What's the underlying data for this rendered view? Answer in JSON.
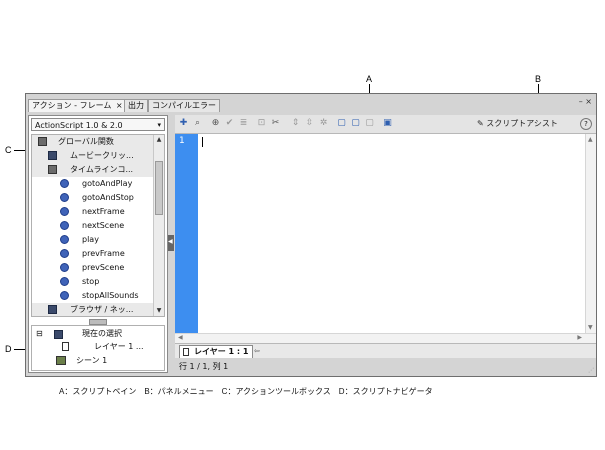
{
  "callouts": {
    "a": "A",
    "b": "B",
    "c": "C",
    "d": "D"
  },
  "tabs": [
    {
      "label": "アクション - フレーム",
      "close": "×"
    },
    {
      "label": "出力"
    },
    {
      "label": "コンパイルエラー"
    }
  ],
  "window_controls": {
    "min": "–",
    "close": "×"
  },
  "language_select": {
    "value": "ActionScript 1.0 & 2.0",
    "arrow": "▾"
  },
  "toolbox": {
    "items": [
      {
        "label": "グローバル関数",
        "kind": "folder-open"
      },
      {
        "label": "ムービークリッ...",
        "kind": "folder"
      },
      {
        "label": "タイムラインコ...",
        "kind": "folder-open"
      },
      {
        "label": "gotoAndPlay",
        "kind": "fn"
      },
      {
        "label": "gotoAndStop",
        "kind": "fn"
      },
      {
        "label": "nextFrame",
        "kind": "fn"
      },
      {
        "label": "nextScene",
        "kind": "fn"
      },
      {
        "label": "play",
        "kind": "fn"
      },
      {
        "label": "prevFrame",
        "kind": "fn"
      },
      {
        "label": "prevScene",
        "kind": "fn"
      },
      {
        "label": "stop",
        "kind": "fn"
      },
      {
        "label": "stopAllSounds",
        "kind": "fn"
      },
      {
        "label": "ブラウザ / ネッ...",
        "kind": "folder"
      }
    ]
  },
  "navigator": {
    "items": [
      {
        "label": "現在の選択",
        "toggle": "⊟"
      },
      {
        "label": "レイヤー 1 ..."
      },
      {
        "label": "シーン 1"
      }
    ]
  },
  "toolbar": {
    "script_assist": "スクリプトアシスト",
    "help": "?"
  },
  "editor": {
    "line_number": "1"
  },
  "layer_tab": {
    "label": "レイヤー 1 : 1"
  },
  "status": {
    "position": "行 1 / 1, 列 1"
  },
  "caption": "A：スクリプトペイン　B：パネルメニュー　C：アクションツールボックス　D：スクリプトナビゲータ"
}
